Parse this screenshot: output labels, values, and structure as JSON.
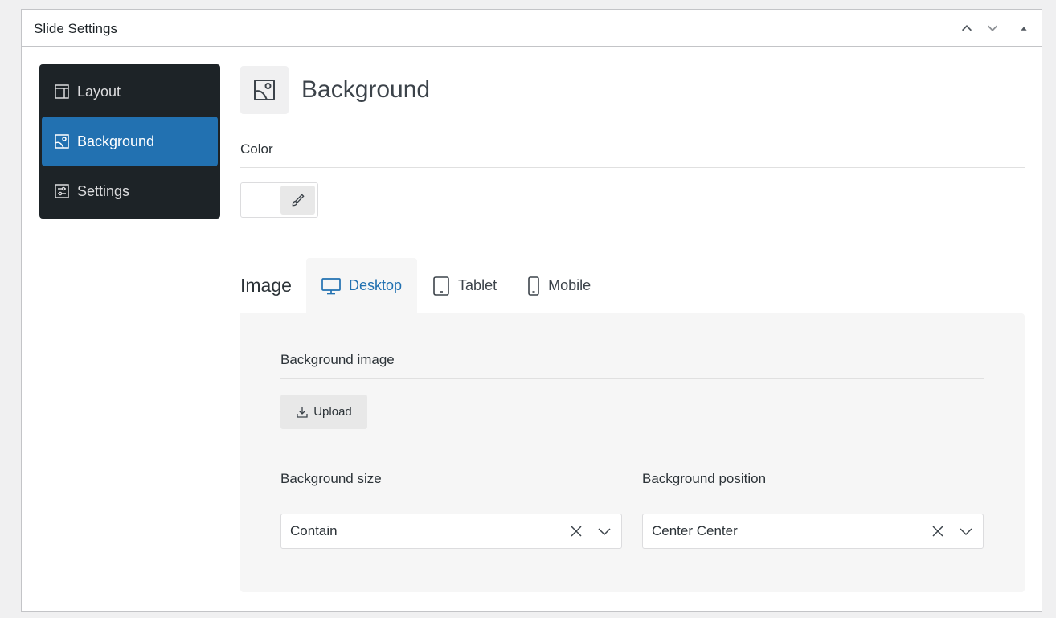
{
  "panel": {
    "title": "Slide Settings"
  },
  "sidebar": {
    "items": [
      {
        "label": "Layout",
        "icon": "layout-icon",
        "active": false
      },
      {
        "label": "Background",
        "icon": "image-icon",
        "active": true
      },
      {
        "label": "Settings",
        "icon": "sliders-icon",
        "active": false
      }
    ]
  },
  "section": {
    "title": "Background",
    "color_label": "Color",
    "image_title": "Image",
    "tabs": [
      {
        "label": "Desktop",
        "icon": "desktop-icon",
        "active": true
      },
      {
        "label": "Tablet",
        "icon": "tablet-icon",
        "active": false
      },
      {
        "label": "Mobile",
        "icon": "mobile-icon",
        "active": false
      }
    ],
    "background_image_label": "Background image",
    "upload_label": "Upload",
    "size_label": "Background size",
    "size_value": "Contain",
    "position_label": "Background position",
    "position_value": "Center Center"
  },
  "colors": {
    "accent": "#2271b1",
    "sidebar_bg": "#1d2327"
  }
}
